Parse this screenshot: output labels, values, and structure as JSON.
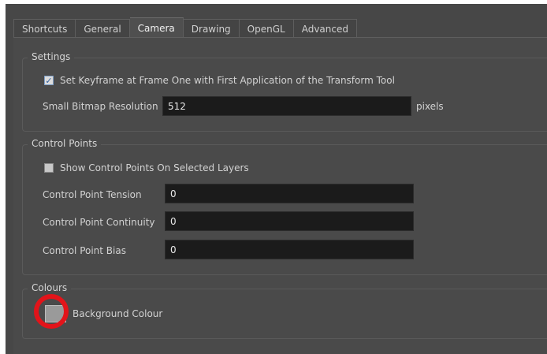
{
  "tabs": [
    {
      "label": "Shortcuts"
    },
    {
      "label": "General"
    },
    {
      "label": "Camera"
    },
    {
      "label": "Drawing"
    },
    {
      "label": "OpenGL"
    },
    {
      "label": "Advanced"
    }
  ],
  "active_tab": "Camera",
  "settings": {
    "title": "Settings",
    "keyframe_checkbox_label": "Set Keyframe at Frame One with First Application of the Transform Tool",
    "keyframe_checked": true,
    "bitmap_label": "Small Bitmap Resolution",
    "bitmap_value": "512",
    "bitmap_unit": "pixels"
  },
  "control_points": {
    "title": "Control Points",
    "show_checkbox_label": "Show Control Points On Selected Layers",
    "show_checked": false,
    "tension_label": "Control Point Tension",
    "tension_value": "0",
    "continuity_label": "Control Point Continuity",
    "continuity_value": "0",
    "bias_label": "Control Point Bias",
    "bias_value": "0"
  },
  "colours": {
    "title": "Colours",
    "background_label": "Background Colour",
    "background_color": "#9a9a9a"
  },
  "highlight_color": "#e2141a"
}
